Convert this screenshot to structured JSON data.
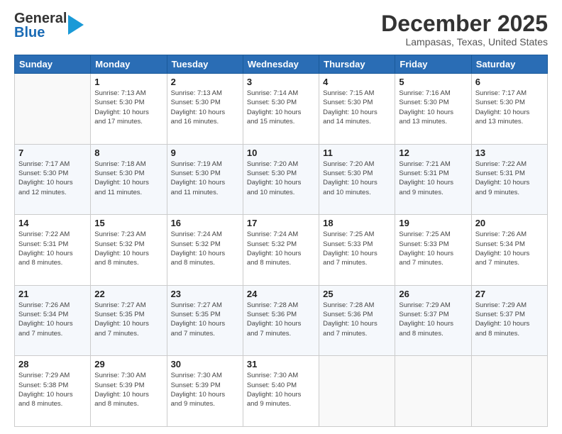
{
  "header": {
    "logo_line1": "General",
    "logo_line2": "Blue",
    "title": "December 2025",
    "subtitle": "Lampasas, Texas, United States"
  },
  "days": [
    "Sunday",
    "Monday",
    "Tuesday",
    "Wednesday",
    "Thursday",
    "Friday",
    "Saturday"
  ],
  "weeks": [
    [
      {
        "day": "",
        "info": ""
      },
      {
        "day": "1",
        "info": "Sunrise: 7:13 AM\nSunset: 5:30 PM\nDaylight: 10 hours\nand 17 minutes."
      },
      {
        "day": "2",
        "info": "Sunrise: 7:13 AM\nSunset: 5:30 PM\nDaylight: 10 hours\nand 16 minutes."
      },
      {
        "day": "3",
        "info": "Sunrise: 7:14 AM\nSunset: 5:30 PM\nDaylight: 10 hours\nand 15 minutes."
      },
      {
        "day": "4",
        "info": "Sunrise: 7:15 AM\nSunset: 5:30 PM\nDaylight: 10 hours\nand 14 minutes."
      },
      {
        "day": "5",
        "info": "Sunrise: 7:16 AM\nSunset: 5:30 PM\nDaylight: 10 hours\nand 13 minutes."
      },
      {
        "day": "6",
        "info": "Sunrise: 7:17 AM\nSunset: 5:30 PM\nDaylight: 10 hours\nand 13 minutes."
      }
    ],
    [
      {
        "day": "7",
        "info": "Sunrise: 7:17 AM\nSunset: 5:30 PM\nDaylight: 10 hours\nand 12 minutes."
      },
      {
        "day": "8",
        "info": "Sunrise: 7:18 AM\nSunset: 5:30 PM\nDaylight: 10 hours\nand 11 minutes."
      },
      {
        "day": "9",
        "info": "Sunrise: 7:19 AM\nSunset: 5:30 PM\nDaylight: 10 hours\nand 11 minutes."
      },
      {
        "day": "10",
        "info": "Sunrise: 7:20 AM\nSunset: 5:30 PM\nDaylight: 10 hours\nand 10 minutes."
      },
      {
        "day": "11",
        "info": "Sunrise: 7:20 AM\nSunset: 5:30 PM\nDaylight: 10 hours\nand 10 minutes."
      },
      {
        "day": "12",
        "info": "Sunrise: 7:21 AM\nSunset: 5:31 PM\nDaylight: 10 hours\nand 9 minutes."
      },
      {
        "day": "13",
        "info": "Sunrise: 7:22 AM\nSunset: 5:31 PM\nDaylight: 10 hours\nand 9 minutes."
      }
    ],
    [
      {
        "day": "14",
        "info": "Sunrise: 7:22 AM\nSunset: 5:31 PM\nDaylight: 10 hours\nand 8 minutes."
      },
      {
        "day": "15",
        "info": "Sunrise: 7:23 AM\nSunset: 5:32 PM\nDaylight: 10 hours\nand 8 minutes."
      },
      {
        "day": "16",
        "info": "Sunrise: 7:24 AM\nSunset: 5:32 PM\nDaylight: 10 hours\nand 8 minutes."
      },
      {
        "day": "17",
        "info": "Sunrise: 7:24 AM\nSunset: 5:32 PM\nDaylight: 10 hours\nand 8 minutes."
      },
      {
        "day": "18",
        "info": "Sunrise: 7:25 AM\nSunset: 5:33 PM\nDaylight: 10 hours\nand 7 minutes."
      },
      {
        "day": "19",
        "info": "Sunrise: 7:25 AM\nSunset: 5:33 PM\nDaylight: 10 hours\nand 7 minutes."
      },
      {
        "day": "20",
        "info": "Sunrise: 7:26 AM\nSunset: 5:34 PM\nDaylight: 10 hours\nand 7 minutes."
      }
    ],
    [
      {
        "day": "21",
        "info": "Sunrise: 7:26 AM\nSunset: 5:34 PM\nDaylight: 10 hours\nand 7 minutes."
      },
      {
        "day": "22",
        "info": "Sunrise: 7:27 AM\nSunset: 5:35 PM\nDaylight: 10 hours\nand 7 minutes."
      },
      {
        "day": "23",
        "info": "Sunrise: 7:27 AM\nSunset: 5:35 PM\nDaylight: 10 hours\nand 7 minutes."
      },
      {
        "day": "24",
        "info": "Sunrise: 7:28 AM\nSunset: 5:36 PM\nDaylight: 10 hours\nand 7 minutes."
      },
      {
        "day": "25",
        "info": "Sunrise: 7:28 AM\nSunset: 5:36 PM\nDaylight: 10 hours\nand 7 minutes."
      },
      {
        "day": "26",
        "info": "Sunrise: 7:29 AM\nSunset: 5:37 PM\nDaylight: 10 hours\nand 8 minutes."
      },
      {
        "day": "27",
        "info": "Sunrise: 7:29 AM\nSunset: 5:37 PM\nDaylight: 10 hours\nand 8 minutes."
      }
    ],
    [
      {
        "day": "28",
        "info": "Sunrise: 7:29 AM\nSunset: 5:38 PM\nDaylight: 10 hours\nand 8 minutes."
      },
      {
        "day": "29",
        "info": "Sunrise: 7:30 AM\nSunset: 5:39 PM\nDaylight: 10 hours\nand 8 minutes."
      },
      {
        "day": "30",
        "info": "Sunrise: 7:30 AM\nSunset: 5:39 PM\nDaylight: 10 hours\nand 9 minutes."
      },
      {
        "day": "31",
        "info": "Sunrise: 7:30 AM\nSunset: 5:40 PM\nDaylight: 10 hours\nand 9 minutes."
      },
      {
        "day": "",
        "info": ""
      },
      {
        "day": "",
        "info": ""
      },
      {
        "day": "",
        "info": ""
      }
    ]
  ]
}
